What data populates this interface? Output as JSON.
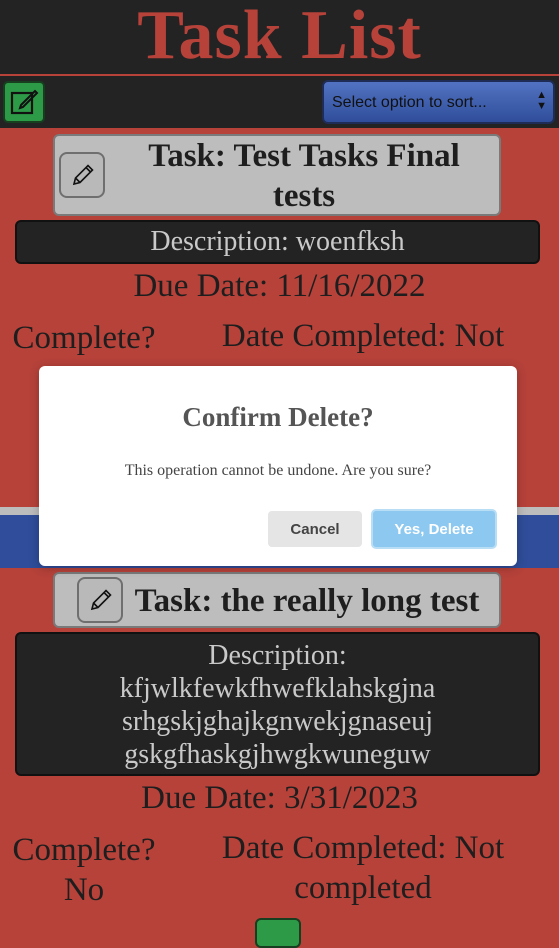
{
  "app": {
    "title": "Task List"
  },
  "toolbar": {
    "sort_placeholder": "Select option to sort..."
  },
  "tasks": [
    {
      "title_line1": "Task: Test Tasks Final",
      "title_line2": "tests",
      "description": "Description: woenfksh",
      "due": "Due Date: 11/16/2022",
      "complete_label": "Complete?",
      "date_completed_line1": "Date Completed: Not"
    },
    {
      "title": "Task: the really long test",
      "desc_lines": [
        "Description:",
        "kfjwlkfewkfhwefklahskgjna",
        "srhgskjghajkgnwekjgnaseuj",
        "gskgfhaskgjhwgkwuneguw"
      ],
      "due": "Due Date: 3/31/2023",
      "complete_label": "Complete?",
      "complete_value": "No",
      "date_completed_line1": "Date Completed: Not",
      "date_completed_line2": "completed"
    }
  ],
  "modal": {
    "title": "Confirm Delete?",
    "message": "This operation cannot be undone. Are you sure?",
    "cancel_label": "Cancel",
    "confirm_label": "Yes, Delete"
  },
  "colors": {
    "page_bg": "#b6423a",
    "header_bg": "#232323",
    "accent_green": "#2d9a47",
    "select_blue": "#2f4d9a",
    "confirm_blue": "#8cc8ef"
  }
}
